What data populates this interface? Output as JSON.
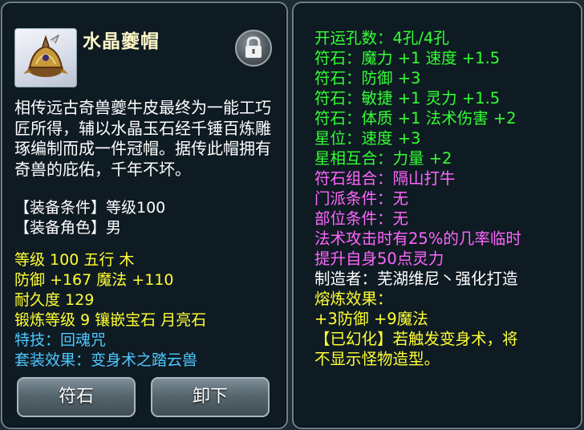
{
  "item": {
    "name": "水晶夔帽",
    "description": "相传远古奇兽夔牛皮最终为一能工巧匠所得，辅以水晶玉石经千锤百炼雕琢编制而成一件冠帽。据传此帽拥有奇兽的庇佑，千年不坏。",
    "requirement_level": "【装备条件】等级100",
    "requirement_role": "【装备角色】男",
    "level_line": "等级 100  五行 木",
    "defense_line": "防御 +167  魔法 +110",
    "durability_line": "耐久度 129",
    "forge_line": "锻炼等级 9  镶嵌宝石 月亮石",
    "skill_line": "特技：回魂咒",
    "set_line": "套装效果：变身术之踏云兽"
  },
  "buttons": {
    "rune": "符石",
    "unequip": "卸下"
  },
  "details": {
    "holes": "开运孔数：4孔/4孔",
    "rune1": "符石：魔力 +1 速度 +1.5",
    "rune2": "符石：防御 +3",
    "rune3": "符石：敏捷 +1 灵力 +1.5",
    "rune4": "符石：体质 +1 法术伤害 +2",
    "star": "星位：速度 +3",
    "constellation": "星相互合：力量 +2",
    "rune_combo": "符石组合：隔山打牛",
    "sect_cond": "门派条件：无",
    "part_cond": "部位条件：无",
    "combo_effect_1": "法术攻击时有25%的几率临时",
    "combo_effect_2": "提升自身50点灵力",
    "maker": "制造者：芜湖维尼丶强化打造",
    "smelt_title": "熔炼效果：",
    "smelt_value": "+3防御 +9魔法",
    "illusion_1": "【已幻化】若触发变身术，将",
    "illusion_2": "不显示怪物造型。"
  },
  "icons": {
    "lock": "lock-icon",
    "item": "helmet-icon"
  },
  "colors": {
    "title": "#fff7c7",
    "stat": "#ffff33",
    "skill": "#4ec7ff",
    "rune": "#33ff33",
    "combo": "#ff66ff"
  }
}
